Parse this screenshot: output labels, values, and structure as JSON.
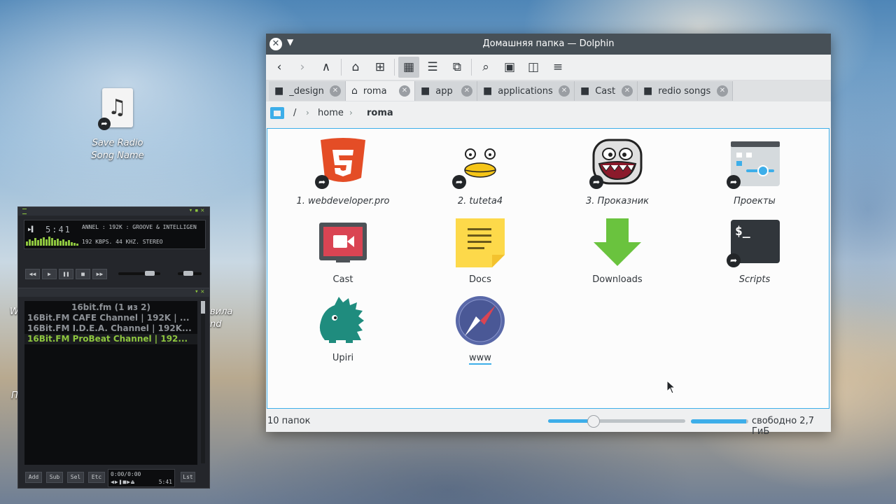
{
  "desktop": {
    "icon_label": "Save Radio Song Name",
    "partial_left_1": "W",
    "partial_right_1": "вила",
    "partial_right_2": "nd",
    "partial_left_2": "П"
  },
  "player": {
    "time": "5:41",
    "marquee": "ANNEL : 192K : GROOVE & INTELLIGEN",
    "info": "192 KBPS. 44 KHZ. STEREO",
    "playlist_header": "16bit.fm (1 из 2)",
    "playlist": [
      "16Bit.FM CAFE Channel | 192K | ...",
      "16Bit.FM I.D.E.A. Channel | 192K...",
      "16Bit.FM ProBeat Channel | 192..."
    ],
    "active_index": 2,
    "bottom_buttons": [
      "Add",
      "Sub",
      "Sel",
      "Etc"
    ],
    "mini_time": "0:00/0:00",
    "mini_time2": "5:41",
    "list_button": "Lst"
  },
  "window": {
    "title": "Домашняя папка — Dolphin"
  },
  "tabs": [
    {
      "label": "_design",
      "icon": "folder-icon",
      "active": false
    },
    {
      "label": "roma",
      "icon": "home-icon",
      "active": true
    },
    {
      "label": "app",
      "icon": "folder-icon",
      "active": false
    },
    {
      "label": "applications",
      "icon": "folder-icon",
      "active": false
    },
    {
      "label": "Cast",
      "icon": "folder-icon",
      "active": false
    },
    {
      "label": "redio songs",
      "icon": "folder-icon",
      "active": false
    }
  ],
  "breadcrumb": {
    "root": "/",
    "home": "home",
    "current": "roma"
  },
  "items": [
    {
      "label": "1. webdeveloper.pro",
      "icon": "html5-icon",
      "link": true
    },
    {
      "label": "2. tuteta4",
      "icon": "bird-icon",
      "link": true
    },
    {
      "label": "3. Проказник",
      "icon": "monster-icon",
      "link": true
    },
    {
      "label": "Проекты",
      "icon": "settings-app-icon",
      "link": true
    },
    {
      "label": "Cast",
      "icon": "video-icon",
      "link": false
    },
    {
      "label": "Docs",
      "icon": "notes-icon",
      "link": false
    },
    {
      "label": "Downloads",
      "icon": "download-icon",
      "link": false
    },
    {
      "label": "Scripts",
      "icon": "terminal-icon",
      "link": true
    },
    {
      "label": "Upiri",
      "icon": "dino-icon",
      "link": false
    },
    {
      "label": "www",
      "icon": "compass-icon",
      "link": false
    }
  ],
  "status": {
    "count": "10 папок",
    "free": "свободно 2,7 ГиБ",
    "zoom_fraction": 0.33,
    "used_fraction": 0.96
  },
  "colors": {
    "accent": "#3daee9",
    "titlebar": "#475057",
    "player_green": "#8ec63f"
  }
}
